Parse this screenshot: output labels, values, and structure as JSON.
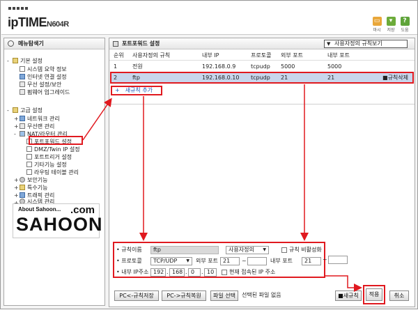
{
  "header": {
    "brand": "ipTIME",
    "model": "N604R",
    "buttons": [
      {
        "label": "마시",
        "icon": "window-icon",
        "color": "#e9a73a"
      },
      {
        "label": "저장",
        "icon": "save-icon",
        "color": "#6cab3a"
      },
      {
        "label": "도움",
        "icon": "help-icon",
        "color": "#5fa43a"
      }
    ]
  },
  "sidebar": {
    "title": "메뉴탐색기",
    "basic": {
      "label": "기본 설정",
      "items": [
        "시스템 요약 정보",
        "인터넷 연결 설정",
        "무선 설정/보안",
        "펌웨어 업그레이드"
      ]
    },
    "advanced": {
      "label": "고급 설정",
      "items": [
        "네트워크 관리",
        "무선랜 관리",
        "NAT/라우터 관리"
      ],
      "nat_items": [
        "포트포워드 설정",
        "DMZ/Twin IP 설정",
        "포트트리거 설정",
        "기타기능 설정",
        "라우팅 테이블 관리"
      ],
      "more_items": [
        "보안기능",
        "특수기능",
        "트래픽 관리",
        "시스템 관리"
      ]
    },
    "banner": {
      "about": "About Sahoon...",
      "com": ".com",
      "name": "SAHOON"
    }
  },
  "main": {
    "title": "포트포워드 설정",
    "view_select": "사용자정의 규칙보기",
    "columns": [
      "순위",
      "사용자정의 규칙",
      "내부 IP",
      "프로토콜",
      "외부 포트",
      "내부 포트"
    ],
    "rows": [
      {
        "rank": "1",
        "name": "전원",
        "ip": "192.168.0.9",
        "protocol": "tcpudp",
        "ext_port": "5000",
        "int_port": "5000"
      },
      {
        "rank": "2",
        "name": "ftp",
        "ip": "192.168.0.10",
        "protocol": "tcpudp",
        "ext_port": "21",
        "int_port": "21",
        "action": "규칙삭제"
      }
    ],
    "add_rule": "새규칙 추가"
  },
  "form": {
    "rule_name_label": "규칙이름",
    "rule_name_value": "ftp",
    "rule_type": "사용자정의",
    "disable_label": "규칙 비활성화",
    "protocol_label": "프로토콜",
    "protocol_value": "TCP/UDP",
    "ext_port_label": "외부 포트",
    "ext_port_from": "21",
    "ext_port_to": "",
    "int_port_label": "내부 포트",
    "int_port_from": "21",
    "int_port_to": "",
    "ip_label": "내부 IP주소",
    "ip": [
      "192",
      "168",
      "0",
      "10"
    ],
    "current_ip_label": "현재 접속된 IP 주소"
  },
  "footer": {
    "pc_save": "PC<-규칙저장",
    "pc_restore": "PC->규칙복원",
    "file_select": "파일 선택",
    "no_file": "선택된 파일 없음",
    "new_rule": "새규칙",
    "apply": "적용",
    "cancel": "취소"
  },
  "colors": {
    "highlight": "#e0191f",
    "selected_row": "#c8d6ec",
    "link": "#1a56b8"
  }
}
